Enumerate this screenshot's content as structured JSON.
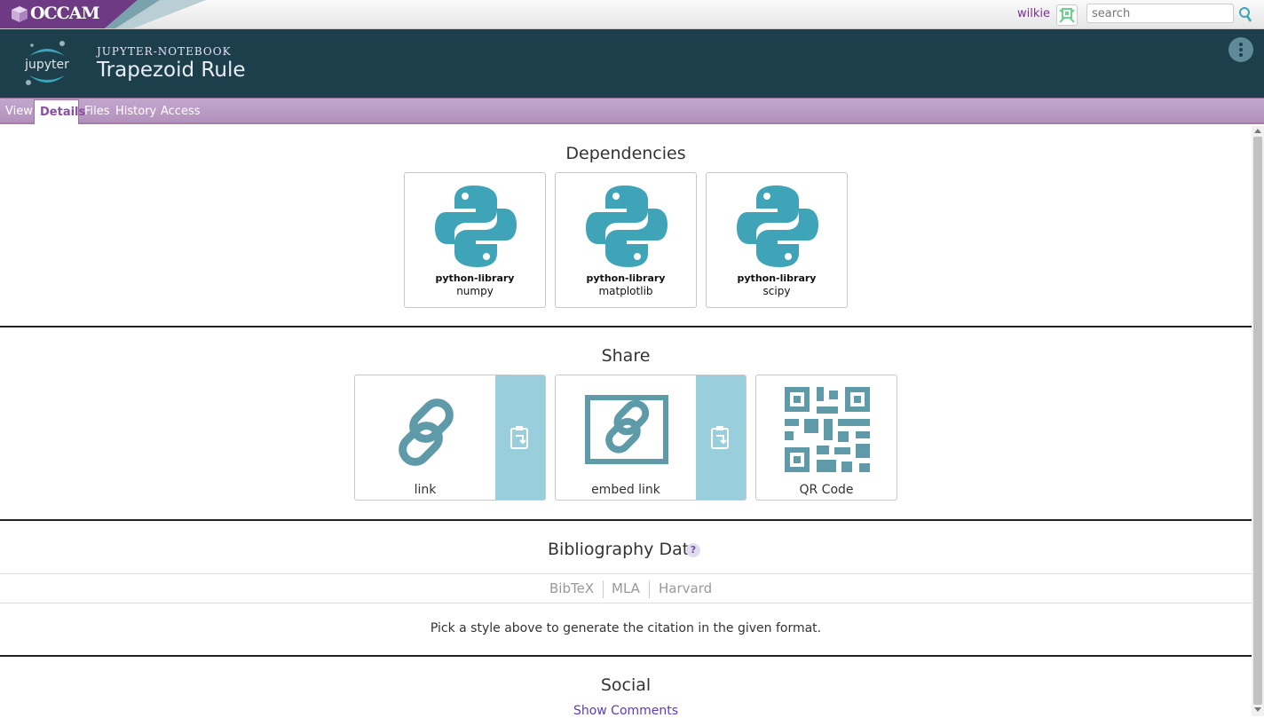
{
  "topbar": {
    "brand": "OCCAM",
    "username": "wilkie",
    "search_placeholder": "search"
  },
  "header": {
    "object_type": "jupyter-notebook",
    "object_name": "Trapezoid Rule",
    "logo_text": "jupyter"
  },
  "tabs": [
    {
      "label": "View"
    },
    {
      "label": "Details",
      "active": true
    },
    {
      "label": "Files"
    },
    {
      "label": "History"
    },
    {
      "label": "Access"
    }
  ],
  "dependencies": {
    "title": "Dependencies",
    "items": [
      {
        "type": "python-library",
        "name": "numpy",
        "icon": "python-logo-icon"
      },
      {
        "type": "python-library",
        "name": "matplotlib",
        "icon": "python-logo-icon"
      },
      {
        "type": "python-library",
        "name": "scipy",
        "icon": "python-logo-icon"
      }
    ]
  },
  "share": {
    "title": "Share",
    "items": [
      {
        "label": "link",
        "icon": "link-icon",
        "copy": true
      },
      {
        "label": "embed link",
        "icon": "embed-link-icon",
        "copy": true
      },
      {
        "label": "QR Code",
        "icon": "qr-code-icon",
        "copy": false
      }
    ]
  },
  "bibliography": {
    "title": "Bibliography Data",
    "help": "?",
    "styles": [
      "BibTeX",
      "MLA",
      "Harvard"
    ],
    "hint": "Pick a style above to generate the citation in the given format."
  },
  "social": {
    "title": "Social",
    "show_comments": "Show Comments"
  },
  "colors": {
    "header_bg": "#1c3f4b",
    "tab_bar": "#b99bc3",
    "accent_teal": "#3fa4b8",
    "copy_bg": "#99cedc",
    "link_purple": "#7a2f97"
  }
}
